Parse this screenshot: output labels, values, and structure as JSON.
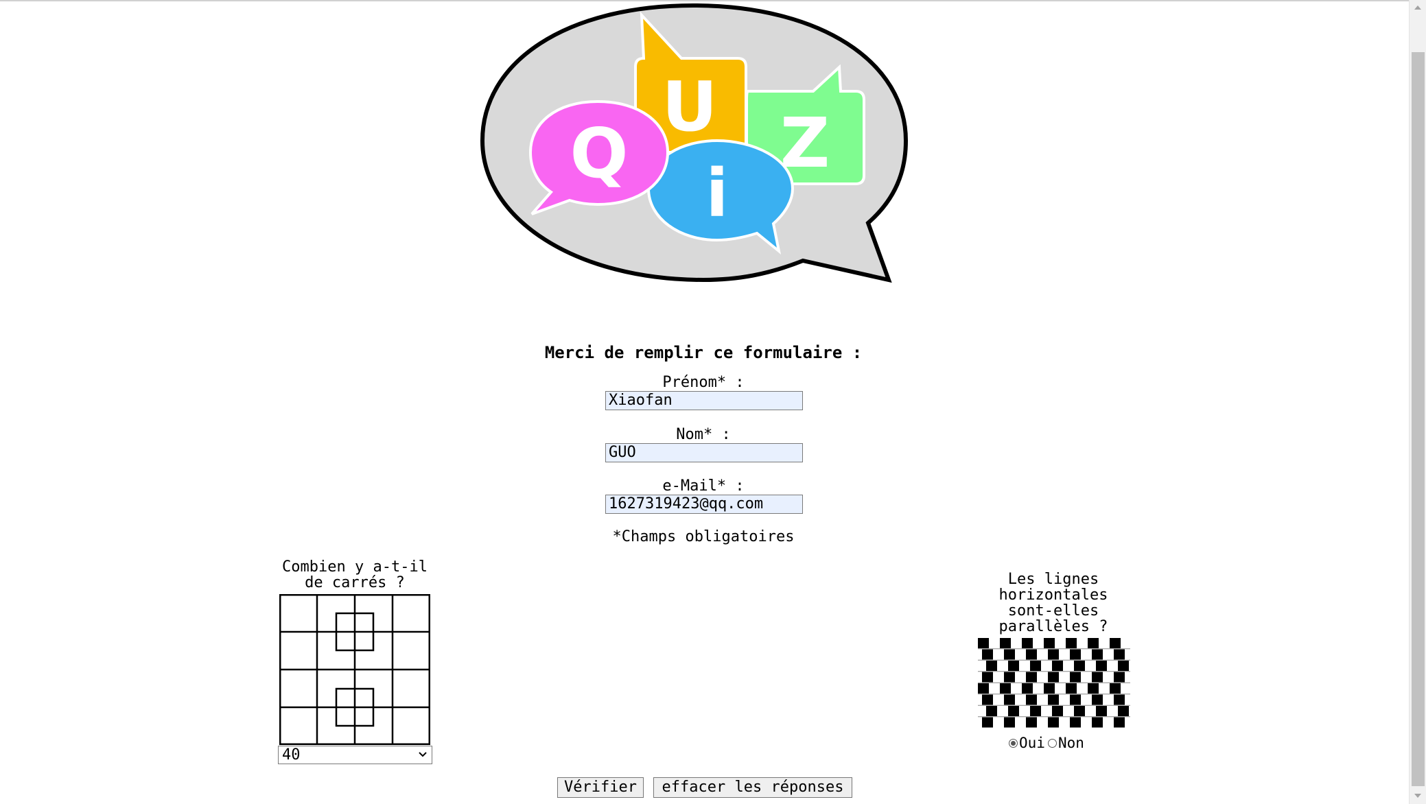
{
  "logo": {
    "letters": [
      "Q",
      "U",
      "i",
      "Z"
    ],
    "colors": {
      "q": "#f966f2",
      "u": "#f9bb00",
      "i": "#3ab0f1",
      "z": "#7ffc90",
      "bubble": "#d9d9d9"
    }
  },
  "form": {
    "title": "Merci de remplir ce formulaire :",
    "prenom_label": "Prénom* :",
    "prenom_value": "Xiaofan",
    "nom_label": "Nom* :",
    "nom_value": "GUO",
    "email_label": "e-Mail* :",
    "email_value": "1627319423@qq.com",
    "required_note": "*Champs obligatoires"
  },
  "question_squares": {
    "line1": "Combien y a-t-il",
    "line2": "de carrés ?",
    "selected_answer": "40"
  },
  "question_lines": {
    "line1": "Les lignes",
    "line2": "horizontales",
    "line3": "sont-elles",
    "line4": "parallèles ?",
    "option_yes": "Oui",
    "option_no": "Non",
    "selected": "Oui"
  },
  "buttons": {
    "verify": "Vérifier",
    "reset": "effacer les réponses"
  }
}
